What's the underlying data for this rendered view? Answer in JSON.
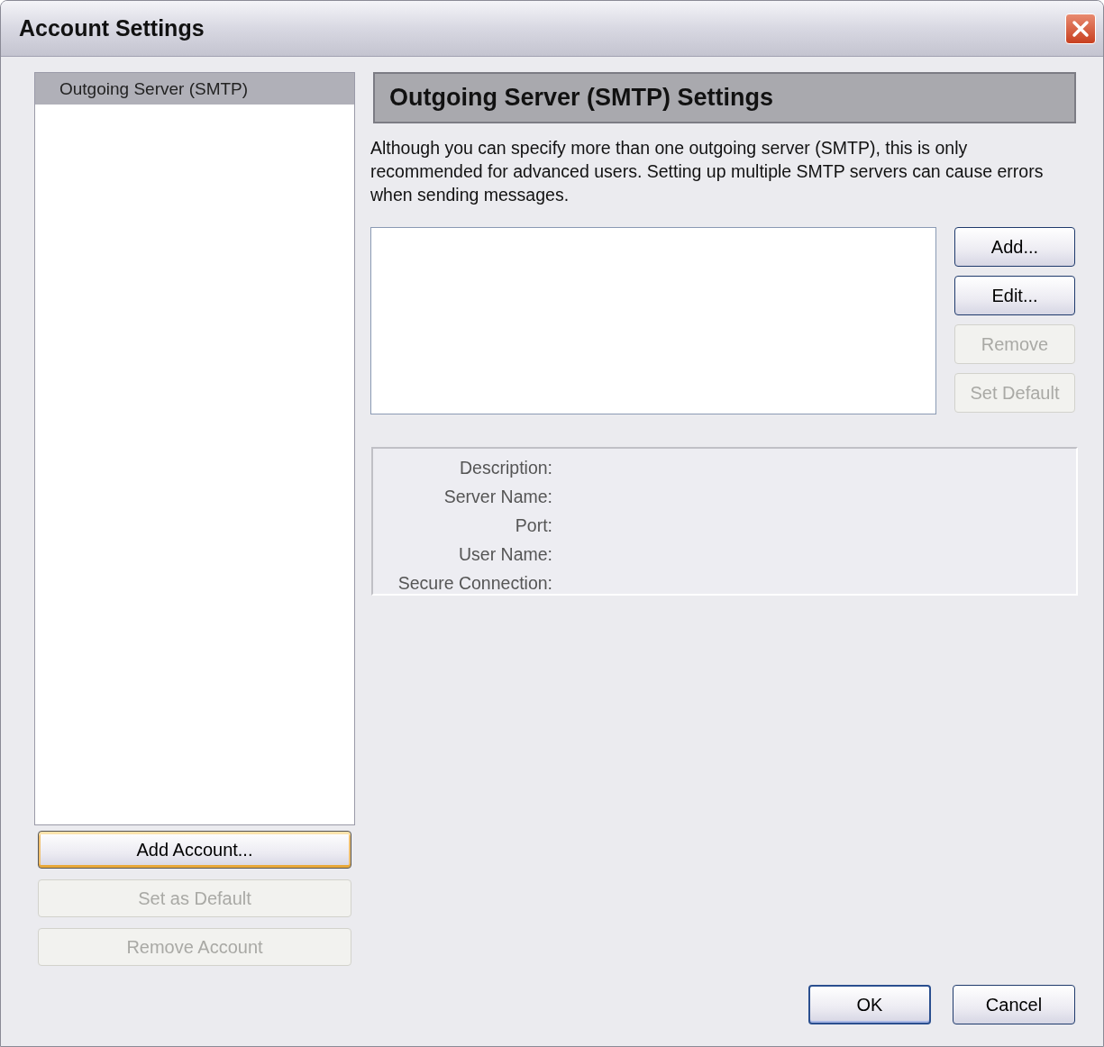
{
  "window": {
    "title": "Account Settings"
  },
  "accounts": {
    "items": [
      {
        "label": "Outgoing Server (SMTP)",
        "selected": true
      }
    ],
    "buttons": [
      {
        "label": "Add Account...",
        "disabled": false,
        "focused": true
      },
      {
        "label": "Set as Default",
        "disabled": true,
        "focused": false
      },
      {
        "label": "Remove Account",
        "disabled": true,
        "focused": false
      }
    ]
  },
  "smtp": {
    "heading": "Outgoing Server (SMTP) Settings",
    "note": "Although you can specify more than one outgoing server (SMTP), this is only recommended for advanced users. Setting up multiple SMTP servers can cause errors when sending messages.",
    "buttons": [
      {
        "label": "Add...",
        "disabled": false
      },
      {
        "label": "Edit...",
        "disabled": false
      },
      {
        "label": "Remove",
        "disabled": true
      },
      {
        "label": "Set Default",
        "disabled": true
      }
    ],
    "details": [
      "Description:",
      "Server Name:",
      "Port:",
      "User Name:",
      "Secure Connection:"
    ]
  },
  "footer": {
    "buttons": [
      {
        "label": "OK",
        "default": true
      },
      {
        "label": "Cancel",
        "default": false
      }
    ]
  }
}
